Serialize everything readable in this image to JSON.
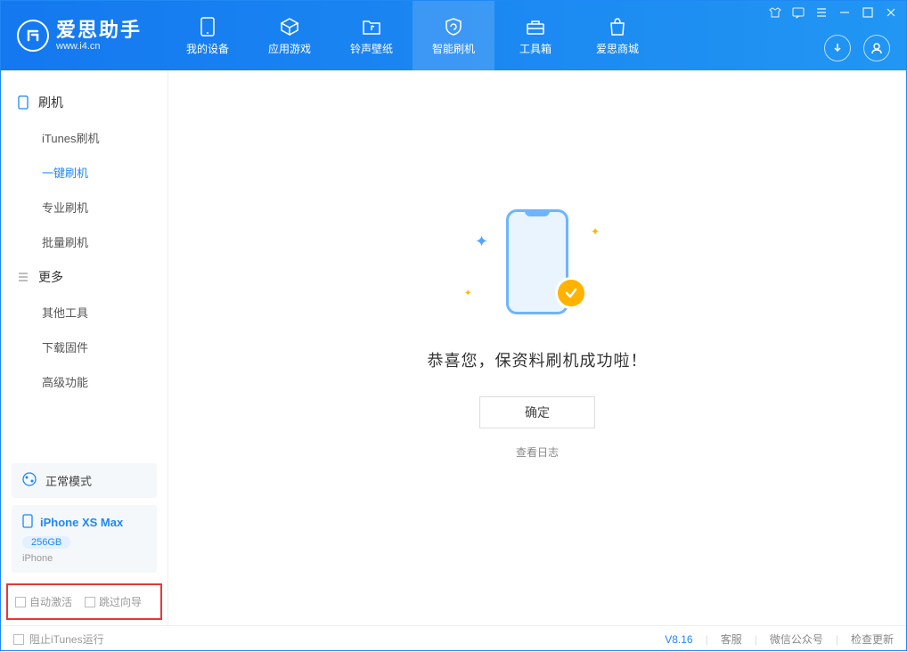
{
  "app": {
    "title": "爱思助手",
    "subtitle": "www.i4.cn"
  },
  "nav": {
    "items": [
      {
        "label": "我的设备"
      },
      {
        "label": "应用游戏"
      },
      {
        "label": "铃声壁纸"
      },
      {
        "label": "智能刷机"
      },
      {
        "label": "工具箱"
      },
      {
        "label": "爱思商城"
      }
    ]
  },
  "sidebar": {
    "section1": {
      "title": "刷机",
      "items": [
        {
          "label": "iTunes刷机"
        },
        {
          "label": "一键刷机"
        },
        {
          "label": "专业刷机"
        },
        {
          "label": "批量刷机"
        }
      ]
    },
    "section2": {
      "title": "更多",
      "items": [
        {
          "label": "其他工具"
        },
        {
          "label": "下载固件"
        },
        {
          "label": "高级功能"
        }
      ]
    },
    "status": {
      "label": "正常模式"
    },
    "device": {
      "name": "iPhone XS Max",
      "storage": "256GB",
      "type": "iPhone"
    },
    "options": {
      "auto_activate": "自动激活",
      "skip_guide": "跳过向导"
    }
  },
  "main": {
    "success_message": "恭喜您，保资料刷机成功啦！",
    "ok_button": "确定",
    "view_log": "查看日志"
  },
  "footer": {
    "block_itunes": "阻止iTunes运行",
    "version": "V8.16",
    "links": {
      "support": "客服",
      "wechat": "微信公众号",
      "update": "检查更新"
    }
  }
}
